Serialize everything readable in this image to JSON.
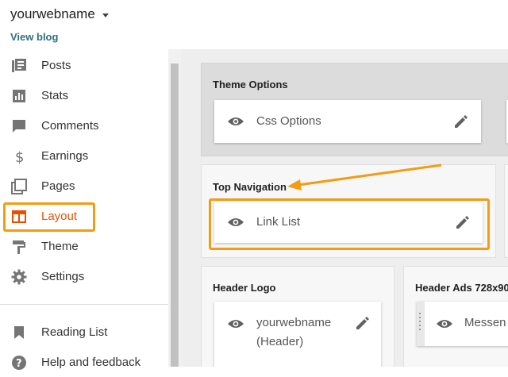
{
  "header": {
    "blog_name": "yourwebname",
    "view_blog": "View blog"
  },
  "sidebar": {
    "items": [
      {
        "label": "Posts",
        "icon": "posts-icon"
      },
      {
        "label": "Stats",
        "icon": "stats-icon"
      },
      {
        "label": "Comments",
        "icon": "comments-icon"
      },
      {
        "label": "Earnings",
        "icon": "dollar-icon"
      },
      {
        "label": "Pages",
        "icon": "pages-icon"
      },
      {
        "label": "Layout",
        "icon": "layout-icon"
      },
      {
        "label": "Theme",
        "icon": "paint-roller-icon"
      },
      {
        "label": "Settings",
        "icon": "gear-icon"
      }
    ],
    "secondary": [
      {
        "label": "Reading List",
        "icon": "bookmark-icon"
      },
      {
        "label": "Help and feedback",
        "icon": "help-icon"
      }
    ],
    "active_label": "Layout"
  },
  "layout": {
    "theme_options": {
      "title": "Theme Options",
      "widget": "Css Options"
    },
    "top_navigation": {
      "title": "Top Navigation",
      "widget": "Link List"
    },
    "header_logo": {
      "title": "Header Logo",
      "widget_line1": "yourwebname",
      "widget_line2": "(Header)"
    },
    "header_ads": {
      "title": "Header Ads 728x90",
      "widget": "Messen"
    }
  },
  "colors": {
    "accent": "#e65100",
    "highlight": "#f39c12",
    "link": "#2e6f80"
  }
}
